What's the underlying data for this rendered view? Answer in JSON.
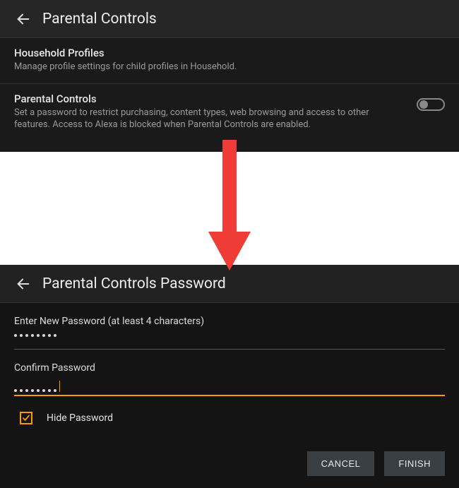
{
  "top": {
    "title": "Parental Controls",
    "section1": {
      "title": "Household Profiles",
      "desc": "Manage profile settings for child profiles in Household."
    },
    "section2": {
      "title": "Parental Controls",
      "desc": "Set a password to restrict purchasing, content types, web browsing and access to other features. Access to Alexa is blocked when Parental Controls are enabled.",
      "toggle_state": "off"
    }
  },
  "bottom": {
    "title": "Parental Controls Password",
    "field1_label": "Enter New Password (at least 4 characters)",
    "field1_len": 8,
    "field2_label": "Confirm Password",
    "field2_len": 8,
    "hide_label": "Hide Password",
    "hide_checked": true,
    "cancel": "CANCEL",
    "finish": "FINISH"
  }
}
